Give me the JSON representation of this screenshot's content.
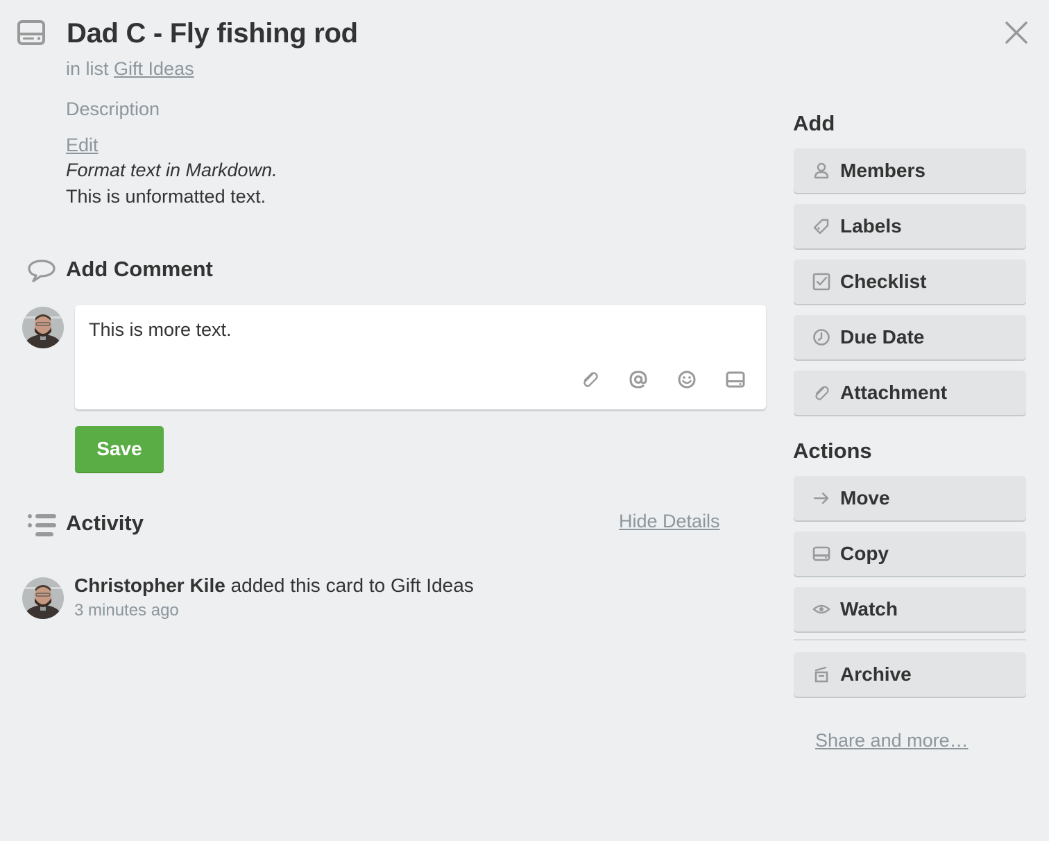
{
  "card": {
    "title": "Dad C - Fly fishing rod",
    "in_list_prefix": "in list",
    "list_name": "Gift Ideas"
  },
  "description": {
    "label": "Description",
    "edit_label": "Edit",
    "italic_line": "Format text in Markdown.",
    "plain_line": "This is unformatted text."
  },
  "comment": {
    "heading": "Add Comment",
    "value": "This is more text.",
    "toolbar_icons": [
      "attachment-icon",
      "mention-icon",
      "emoji-icon",
      "card-icon"
    ],
    "save_label": "Save"
  },
  "activity": {
    "heading": "Activity",
    "toggle_label": "Hide Details",
    "items": [
      {
        "user": "Christopher Kile",
        "action": "added this card to Gift Ideas",
        "time": "3 minutes ago"
      }
    ]
  },
  "sidebar": {
    "add_heading": "Add",
    "add_buttons": [
      {
        "label": "Members",
        "icon": "person-icon"
      },
      {
        "label": "Labels",
        "icon": "tag-icon"
      },
      {
        "label": "Checklist",
        "icon": "checkbox-icon"
      },
      {
        "label": "Due Date",
        "icon": "clock-icon"
      },
      {
        "label": "Attachment",
        "icon": "paperclip-icon"
      }
    ],
    "actions_heading": "Actions",
    "action_buttons": [
      {
        "label": "Move",
        "icon": "arrow-right-icon"
      },
      {
        "label": "Copy",
        "icon": "card-icon"
      },
      {
        "label": "Watch",
        "icon": "eye-icon"
      },
      {
        "label": "Archive",
        "icon": "archive-icon"
      }
    ],
    "share_label": "Share and more…"
  },
  "colors": {
    "background": "#edeff1",
    "save_button": "#5aac44",
    "muted_text": "#8c969c",
    "sidebar_button": "#e2e4e6"
  }
}
